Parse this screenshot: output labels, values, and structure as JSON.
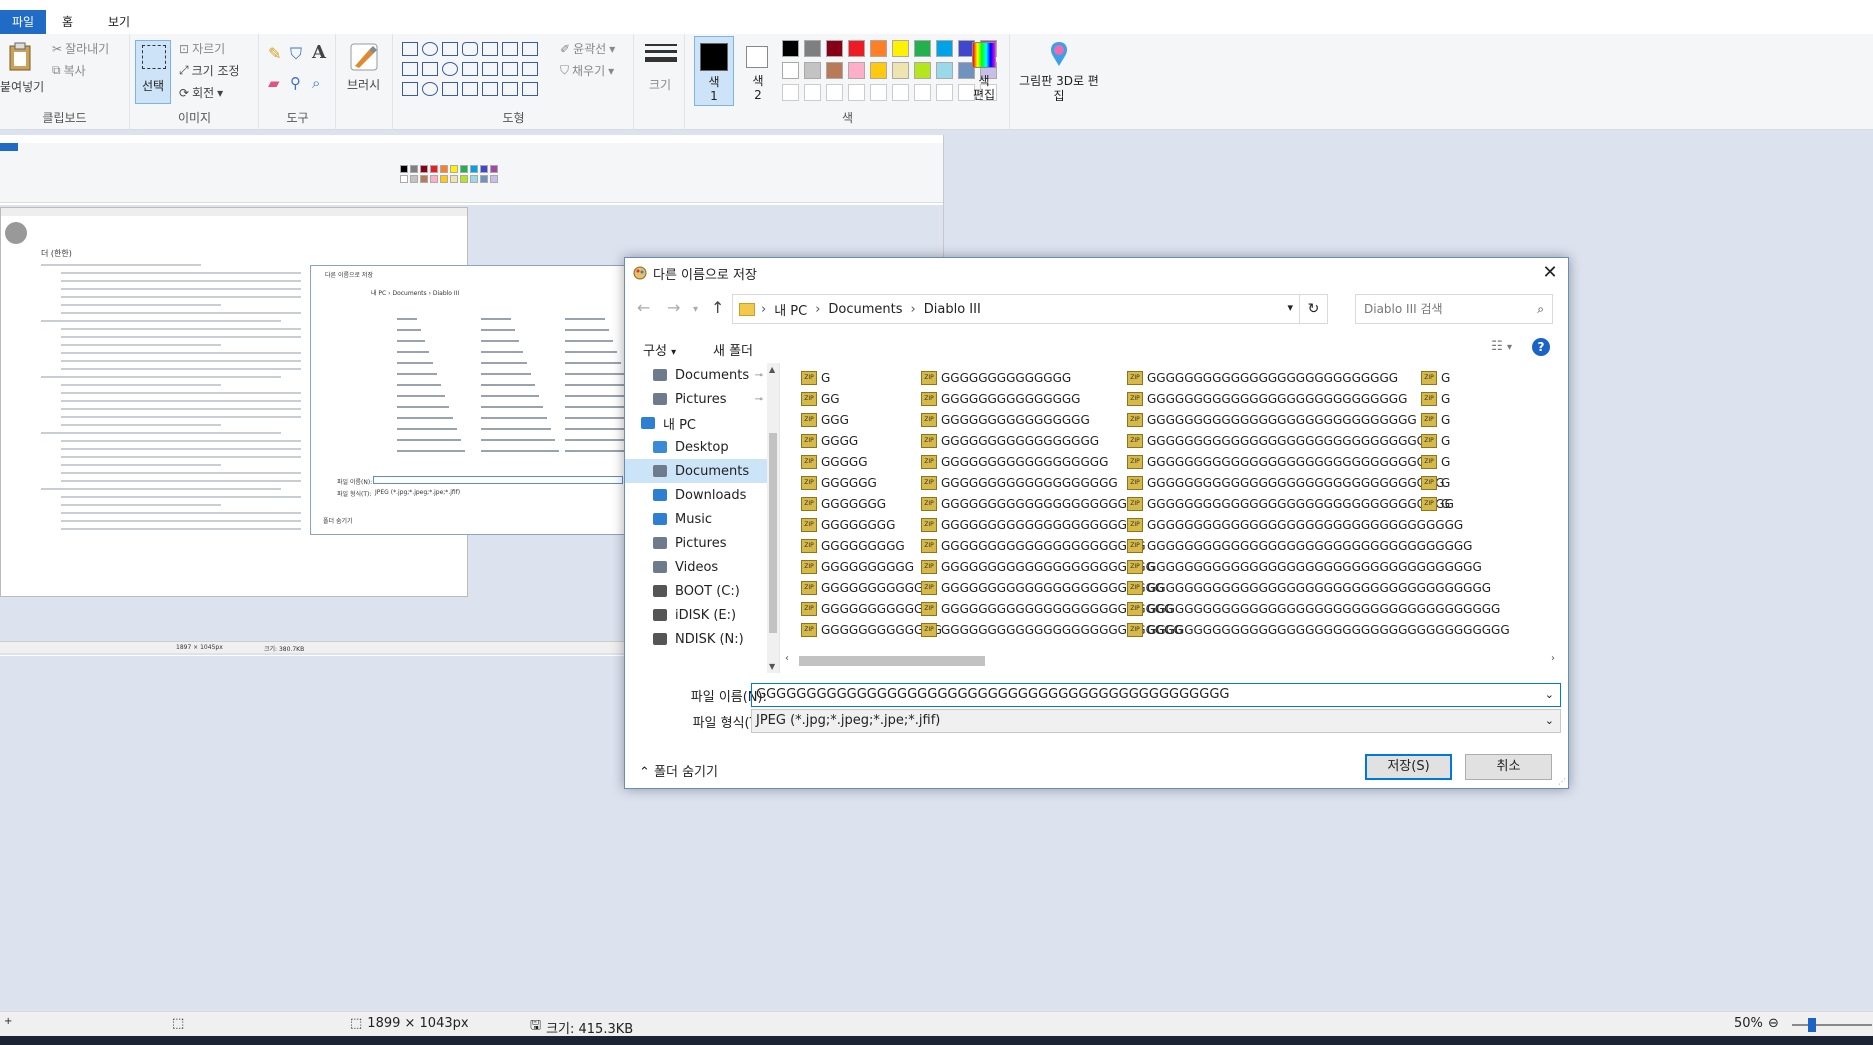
{
  "ribbon": {
    "tabs": [
      "파일",
      "홈",
      "보기"
    ],
    "clipboard": {
      "paste": "붙여넣기",
      "cut": "잘라내기",
      "copy": "복사",
      "label": "클립보드"
    },
    "image": {
      "select": "선택",
      "crop": "자르기",
      "resize": "크기 조정",
      "rotate": "회전",
      "label": "이미지"
    },
    "tools": {
      "label": "도구"
    },
    "brushes": {
      "label": "브러시"
    },
    "shapes": {
      "outline": "윤곽선",
      "fill": "채우기",
      "label": "도형"
    },
    "size": {
      "label": "크기"
    },
    "colors": {
      "color1": "색\n1",
      "color2": "색\n2",
      "edit": "색\n편집",
      "label": "색",
      "palette": [
        "#000000",
        "#7f7f7f",
        "#880015",
        "#ed1c24",
        "#ff7f27",
        "#fff200",
        "#22b14c",
        "#00a2e8",
        "#3f48cc",
        "#a349a4",
        "#ffffff",
        "#c3c3c3",
        "#b97a57",
        "#ffaec9",
        "#ffc90e",
        "#efe4b0",
        "#b5e61d",
        "#99d9ea",
        "#7092be",
        "#c8bfe7"
      ]
    },
    "paint3d": "그림판 3D로 편집"
  },
  "dialog": {
    "title": "다른 이름으로 저장",
    "breadcrumb": [
      "내 PC",
      "Documents",
      "Diablo III"
    ],
    "search_placeholder": "Diablo III 검색",
    "organize": "구성",
    "new_folder": "새 폴더",
    "nav": [
      {
        "label": "Documents",
        "pinned": true
      },
      {
        "label": "Pictures",
        "pinned": true
      },
      {
        "label": "내 PC"
      },
      {
        "label": "Desktop"
      },
      {
        "label": "Documents",
        "selected": true
      },
      {
        "label": "Downloads"
      },
      {
        "label": "Music"
      },
      {
        "label": "Pictures"
      },
      {
        "label": "Videos"
      },
      {
        "label": "BOOT (C:)"
      },
      {
        "label": "iDISK (E:)"
      },
      {
        "label": "NDISK (N:)"
      }
    ],
    "files_col1": [
      "G",
      "GG",
      "GGG",
      "GGGG",
      "GGGGG",
      "GGGGGG",
      "GGGGGGG",
      "GGGGGGGG",
      "GGGGGGGGG",
      "GGGGGGGGGG",
      "GGGGGGGGGGG",
      "GGGGGGGGGGGG",
      "GGGGGGGGGGGGG"
    ],
    "files_col2": [
      "GGGGGGGGGGGGGG",
      "GGGGGGGGGGGGGGG",
      "GGGGGGGGGGGGGGGG",
      "GGGGGGGGGGGGGGGGG",
      "GGGGGGGGGGGGGGGGGG",
      "GGGGGGGGGGGGGGGGGGG",
      "GGGGGGGGGGGGGGGGGGGG",
      "GGGGGGGGGGGGGGGGGGGGG",
      "GGGGGGGGGGGGGGGGGGGGGG",
      "GGGGGGGGGGGGGGGGGGGGGGG",
      "GGGGGGGGGGGGGGGGGGGGGGGG",
      "GGGGGGGGGGGGGGGGGGGGGGGGG",
      "GGGGGGGGGGGGGGGGGGGGGGGGGG"
    ],
    "files_col3": [
      "GGGGGGGGGGGGGGGGGGGGGGGGGGG",
      "GGGGGGGGGGGGGGGGGGGGGGGGGGGG",
      "GGGGGGGGGGGGGGGGGGGGGGGGGGGGG",
      "GGGGGGGGGGGGGGGGGGGGGGGGGGGGGG",
      "GGGGGGGGGGGGGGGGGGGGGGGGGGGGGGG",
      "GGGGGGGGGGGGGGGGGGGGGGGGGGGGGGGG",
      "GGGGGGGGGGGGGGGGGGGGGGGGGGGGGGGGG",
      "GGGGGGGGGGGGGGGGGGGGGGGGGGGGGGGGGG",
      "GGGGGGGGGGGGGGGGGGGGGGGGGGGGGGGGGGG",
      "GGGGGGGGGGGGGGGGGGGGGGGGGGGGGGGGGGGG",
      "GGGGGGGGGGGGGGGGGGGGGGGGGGGGGGGGGGGGG",
      "GGGGGGGGGGGGGGGGGGGGGGGGGGGGGGGGGGGGGG",
      "GGGGGGGGGGGGGGGGGGGGGGGGGGGGGGGGGGGGGGG"
    ],
    "files_col4": [
      "G",
      "G",
      "G",
      "G",
      "G",
      "G",
      "G"
    ],
    "filename_label": "파일 이름(N):",
    "filename_value": "GGGGGGGGGGGGGGGGGGGGGGGGGGGGGGGGGGGGGGGGGGGGGGG",
    "filetype_label": "파일 형식(T):",
    "filetype_value": "JPEG (*.jpg;*.jpeg;*.jpe;*.jfif)",
    "hide_folders": "폴더 숨기기",
    "save": "저장(S)",
    "cancel": "취소"
  },
  "status": {
    "dimensions": "1899 × 1043px",
    "size": "크기: 415.3KB",
    "zoom": "50%"
  },
  "mini": {
    "dialog_title": "다른 이름으로 저장",
    "breadcrumb": "내 PC › Documents › Diablo III",
    "filename_label": "파일 이름(N):",
    "filetype_label": "파일 형식(T):",
    "filetype_value": "JPEG (*.jpg;*.jpeg;*.jpe;*.jfif)",
    "hide": "폴더 숨기기",
    "dims": "1897 × 1045px",
    "size": "크기: 380.7KB",
    "heading": "더 (한한)"
  }
}
